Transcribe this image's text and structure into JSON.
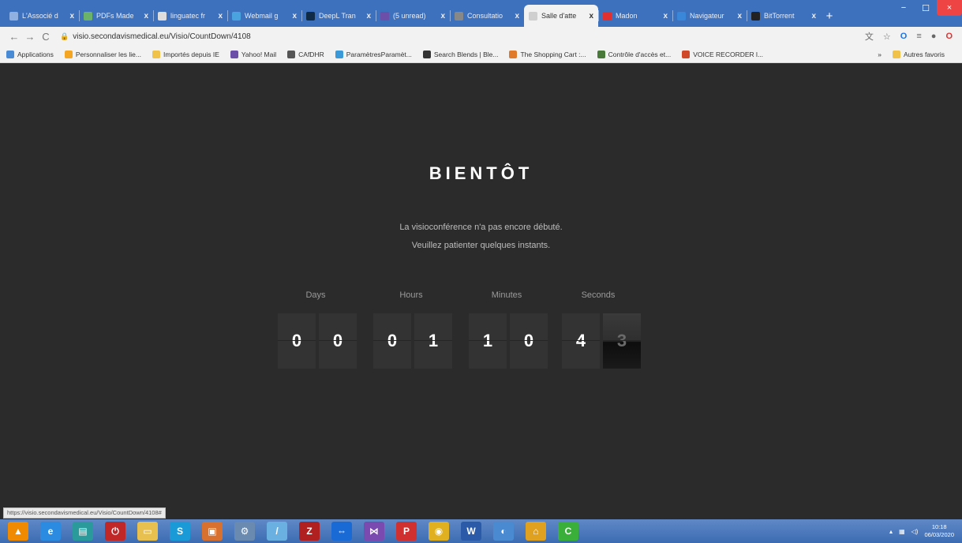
{
  "tabs": [
    {
      "title": "L'Associé d",
      "color": "#8fb0e0"
    },
    {
      "title": "PDFs Made",
      "color": "#6bb36b"
    },
    {
      "title": "linguatec fr",
      "color": "#dddddd"
    },
    {
      "title": "Webmail g",
      "color": "#4aa3df"
    },
    {
      "title": "DeepL Tran",
      "color": "#0f2b46"
    },
    {
      "title": "(5 unread)",
      "color": "#6b4fa8"
    },
    {
      "title": "Consultatio",
      "color": "#888888"
    },
    {
      "title": "Salle d'atte",
      "color": "#cfcfcf"
    },
    {
      "title": "Madon",
      "color": "#e03030"
    },
    {
      "title": "Navigateur",
      "color": "#3a86d8"
    },
    {
      "title": "BitTorrent",
      "color": "#222222"
    }
  ],
  "tab_close": "x",
  "new_tab": "+",
  "window": {
    "minimize": "−",
    "maximize": "☐",
    "close": "×"
  },
  "address": {
    "url": "visio.secondavismedical.eu/Visio/CountDown/4108",
    "lock": "🔒"
  },
  "nav": {
    "back": "←",
    "forward": "→",
    "reload": "C"
  },
  "bookmarks": [
    {
      "label": "Applications",
      "color": "#4a8bd6"
    },
    {
      "label": "Personnaliser les lie...",
      "color": "#f4a623"
    },
    {
      "label": "Importés depuis IE",
      "color": "#f0c24a"
    },
    {
      "label": "Yahoo! Mail",
      "color": "#6b4fa8"
    },
    {
      "label": "CAfDHR",
      "color": "#555555"
    },
    {
      "label": "ParamètresParamèt...",
      "color": "#3a9ad9"
    },
    {
      "label": "Search Blends | Ble...",
      "color": "#333333"
    },
    {
      "label": "The Shopping Cart :...",
      "color": "#e07a2a"
    },
    {
      "label": "Contrôle d'accès et...",
      "color": "#4a7a3a"
    },
    {
      "label": "VOICE RECORDER l...",
      "color": "#d04a2a"
    }
  ],
  "bookmarks_more": "»",
  "bookmarks_other": "Autres favoris",
  "page": {
    "heading": "BIENTÔT",
    "line1": "La visioconférence n'a pas encore débuté.",
    "line2": "Veuillez patienter quelques instants."
  },
  "countdown": {
    "labels": [
      "Days",
      "Hours",
      "Minutes",
      "Seconds"
    ],
    "digits": [
      "0",
      "0",
      "0",
      "1",
      "1",
      "0",
      "4",
      "3"
    ]
  },
  "status_url": "https://visio.secondavismedical.eu/Visio/CountDown/4108#",
  "taskbar": [
    {
      "name": "vlc",
      "glyph": "▲",
      "color": "#f08a00"
    },
    {
      "name": "ie",
      "glyph": "e",
      "color": "#2a8be0"
    },
    {
      "name": "app3",
      "glyph": "▤",
      "color": "#2a9a9a"
    },
    {
      "name": "power",
      "glyph": "⏻",
      "color": "#c02828"
    },
    {
      "name": "explorer",
      "glyph": "▭",
      "color": "#e8c050"
    },
    {
      "name": "skype",
      "glyph": "S",
      "color": "#1a9ad6"
    },
    {
      "name": "app7",
      "glyph": "▣",
      "color": "#d87030"
    },
    {
      "name": "network",
      "glyph": "⚙",
      "color": "#6a8ab0"
    },
    {
      "name": "brush",
      "glyph": "/",
      "color": "#6ab0e0"
    },
    {
      "name": "filezilla",
      "glyph": "Z",
      "color": "#b02020"
    },
    {
      "name": "teamviewer",
      "glyph": "⇔",
      "color": "#1a6ad6"
    },
    {
      "name": "visualstudio",
      "glyph": "⋈",
      "color": "#7a4ab0"
    },
    {
      "name": "pdf",
      "glyph": "P",
      "color": "#d03030"
    },
    {
      "name": "chrome",
      "glyph": "◉",
      "color": "#e0b020"
    },
    {
      "name": "word",
      "glyph": "W",
      "color": "#2a5aa8"
    },
    {
      "name": "app16",
      "glyph": "◐",
      "color": "#4a8ad0"
    },
    {
      "name": "app17",
      "glyph": "⌂",
      "color": "#e0a020"
    },
    {
      "name": "camtasia",
      "glyph": "C",
      "color": "#3ab03a"
    }
  ],
  "clock": {
    "time": "10:18",
    "date": "06/03/2020"
  }
}
